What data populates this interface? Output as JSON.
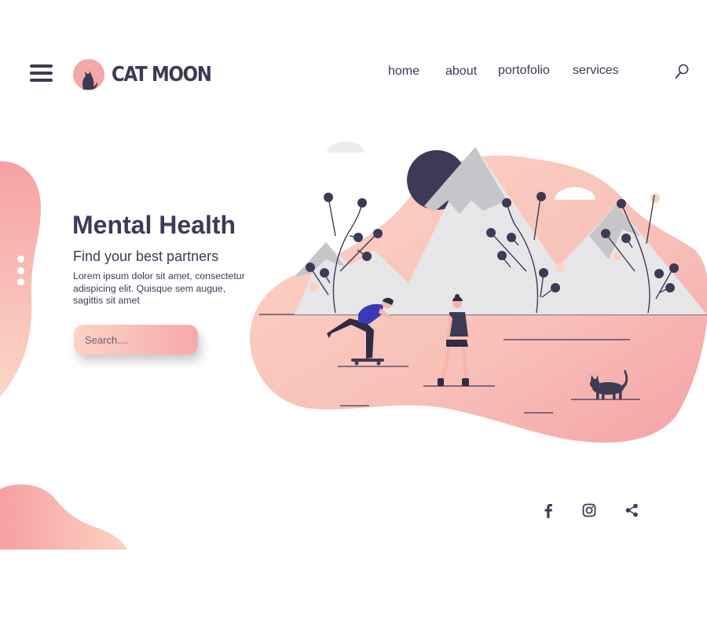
{
  "brand": {
    "name": "CAT MOON"
  },
  "nav": {
    "items": [
      {
        "label": "home"
      },
      {
        "label": "about"
      },
      {
        "label": "portofolio"
      },
      {
        "label": "services"
      }
    ]
  },
  "hero": {
    "title": "Mental Health",
    "subtitle": "Find your best partners",
    "body": "Lorem ipsum dolor sit amet, consectetur adispicing elit. Quisque sem augue, sagittis sit amet",
    "search_placeholder": "Search...."
  },
  "social": {
    "icons": [
      "facebook-icon",
      "instagram-icon",
      "share-icon"
    ]
  },
  "colors": {
    "primary_dark": "#3d3a55",
    "accent_pink": "#f5a3a6",
    "accent_peach": "#fbd0c2",
    "mountain_grey": "#e6e6e9"
  }
}
